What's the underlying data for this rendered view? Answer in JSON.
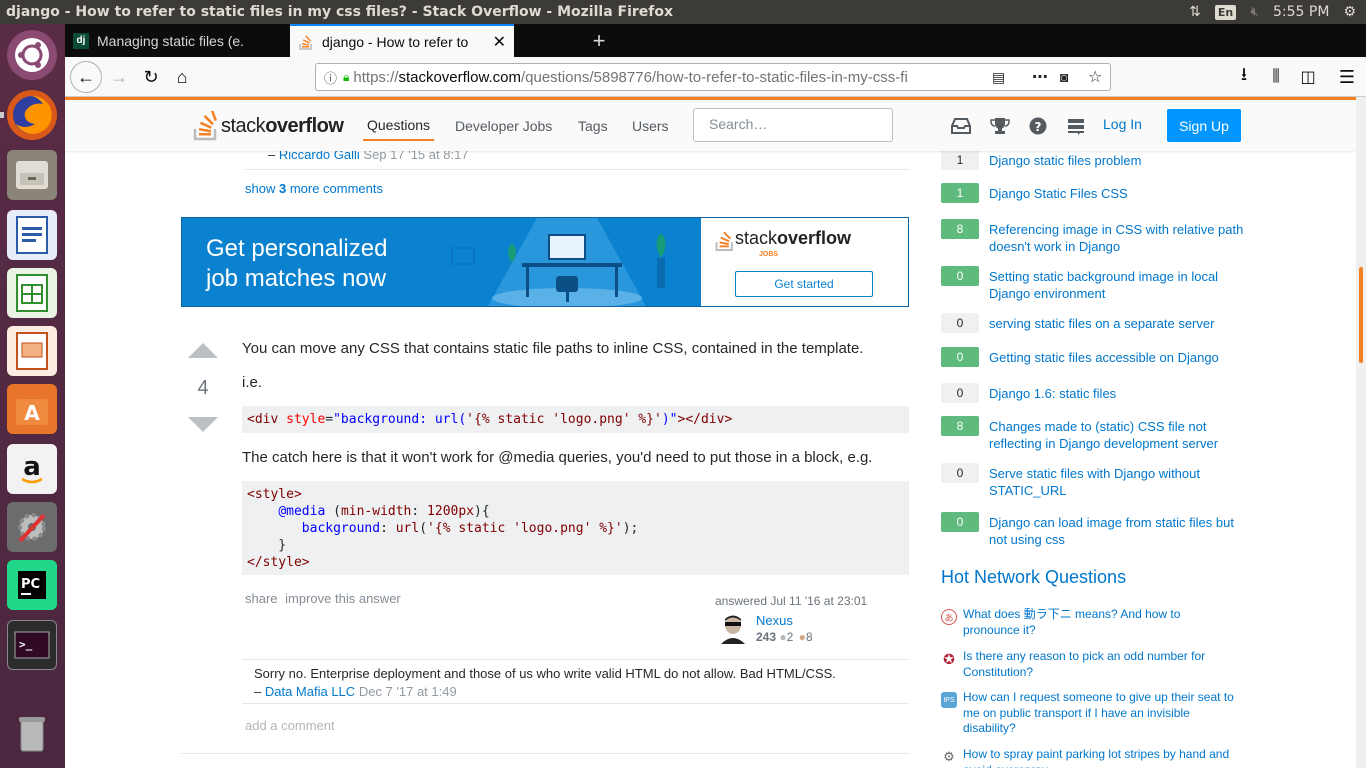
{
  "os": {
    "window_title": "django - How to refer to static files in my css files? - Stack Overflow - Mozilla Firefox",
    "keyboard": "En",
    "clock": "5:55 PM"
  },
  "browser": {
    "tabs": [
      {
        "label": "Managing static files (e.",
        "favicon": "dj",
        "active": false
      },
      {
        "label": "django - How to refer to",
        "favicon": "so",
        "active": true
      }
    ],
    "url_scheme": "https://",
    "url_host": "stackoverflow.com",
    "url_path": "/questions/5898776/how-to-refer-to-static-files-in-my-css-fi"
  },
  "so_header": {
    "logo_light": "stack",
    "logo_bold": "overflow",
    "nav": [
      "Questions",
      "Developer Jobs",
      "Tags",
      "Users"
    ],
    "search_placeholder": "Search…",
    "login": "Log In",
    "signup": "Sign Up"
  },
  "prev_comment": {
    "author": "Riccardo Galli",
    "date": "Sep 17 '15 at 8:17",
    "dash": "–"
  },
  "show_more": {
    "prefix": "show ",
    "count": "3",
    "suffix": " more comments"
  },
  "ad": {
    "headline_1": "Get personalized",
    "headline_2": "job matches now",
    "logo_light": "stack",
    "logo_bold": "overflow",
    "jobs_label": "JOBS",
    "cta": "Get started"
  },
  "answer": {
    "votes": "4",
    "p1": "You can move any CSS that contains static file paths to inline CSS, contained in the template.",
    "p2": "i.e.",
    "p3": "The catch here is that it won't work for @media queries, you'd need to put those in a block, e.g.",
    "share": "share",
    "improve": "improve this answer",
    "answered": "answered Jul 11 '16 at 23:01",
    "user_name": "Nexus",
    "user_rep": "243",
    "silver": "2",
    "bronze": "8"
  },
  "answer_comment": {
    "text": "Sorry no. Enterprise deployment and those of us who write valid HTML do not allow. Bad HTML/CSS.",
    "dash": "–",
    "author": "Data Mafia LLC",
    "date": "Dec 7 '17 at 1:49",
    "add_comment": "add a comment"
  },
  "related": [
    {
      "score": "1",
      "title": "Django static files problem",
      "answered": false
    },
    {
      "score": "1",
      "title": "Django Static Files CSS",
      "answered": true
    },
    {
      "score": "8",
      "title": "Referencing image in CSS with relative path doesn't work in Django",
      "answered": true
    },
    {
      "score": "0",
      "title": "Setting static background image in local Django environment",
      "answered": true
    },
    {
      "score": "0",
      "title": "serving static files on a separate server",
      "answered": false
    },
    {
      "score": "0",
      "title": "Getting static files accessible on Django",
      "answered": true
    },
    {
      "score": "0",
      "title": "Django 1.6: static files",
      "answered": false
    },
    {
      "score": "8",
      "title": "Changes made to (static) CSS file not reflecting in Django development server",
      "answered": true
    },
    {
      "score": "0",
      "title": "Serve static files with Django without STATIC_URL",
      "answered": false
    },
    {
      "score": "0",
      "title": "Django can load image from static files but not using css",
      "answered": true
    }
  ],
  "hnq": {
    "title": "Hot Network Questions",
    "items": [
      {
        "title": "What does 動ラ下ニ means? And how to pronounce it?",
        "icon": "japanese-icon"
      },
      {
        "title": "Is there any reason to pick an odd number for Constitution?",
        "icon": "rpg-icon"
      },
      {
        "title": "How can I request someone to give up their seat to me on public transport if I have an invisible disability?",
        "icon": "ips-icon"
      },
      {
        "title": "How to spray paint parking lot stripes by hand and avoid overspray",
        "icon": "diy-icon"
      }
    ]
  },
  "colors": {
    "accent": "#f48024",
    "link": "#0077cc",
    "accepted": "#5eba7d"
  }
}
